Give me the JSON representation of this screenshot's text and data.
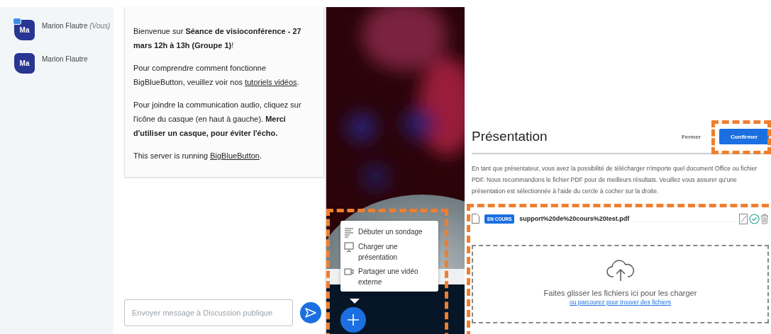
{
  "users": [
    {
      "initials": "Ma",
      "name": "Marion Flautre",
      "suffix": "(Vous)",
      "presenter": true
    },
    {
      "initials": "Ma",
      "name": "Marion Flautre",
      "presenter": false
    }
  ],
  "chat": {
    "paragraphs": [
      [
        {
          "text": "Bienvenue sur **Séance de visioconférence - 27 mars 12h à 13h (Groupe 1)**!"
        }
      ],
      [
        {
          "text": "Pour comprendre comment fonctionne BigBlueButton, veuillez voir nos"
        },
        {
          "link": "tutoriels vidéos"
        },
        {
          "text": "."
        }
      ],
      [
        {
          "text": "Pour joindre la communication audio, cliquez sur l'icône du casque (en haut à gauche). **Merci d'utiliser un casque, pour éviter l'écho.**"
        }
      ],
      [
        {
          "text": "This server is running"
        },
        {
          "link": "BigBlueButton"
        },
        {
          "text": "."
        }
      ]
    ],
    "placeholder": "Envoyer message à Discussion publique"
  },
  "actions_menu": [
    {
      "kind": "poll",
      "label": "Débuter un sondage"
    },
    {
      "kind": "presentation",
      "label": "Charger une présentation"
    },
    {
      "kind": "video",
      "label": "Partager une vidéo externe"
    }
  ],
  "modal": {
    "title": "Présentation",
    "close": "Fermer",
    "confirm": "Confirmer",
    "description": "En tant que présentateur, vous avez la possibilité de télécharger n'importe quel document Office ou fichier PDF. Nous recommandons le fichier PDF pour de meilleurs résultats. Veuillez vous assurer qu'une présentation est sélectionnée à l'aide du cercle à cocher sur la droite.",
    "files": [
      {
        "badge": "EN COURS",
        "name": "support%20de%20cours%20test.pdf",
        "current": true
      }
    ],
    "dropzone": {
      "text": "Faites glisser les fichiers ici pour les charger",
      "link": "ou parcourez pour trouver des fichiers"
    }
  }
}
